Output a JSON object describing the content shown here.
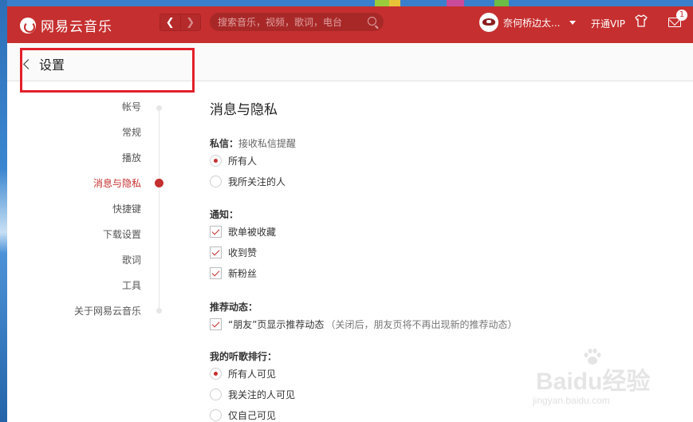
{
  "app": {
    "name": "网易云音乐",
    "search_placeholder": "搜索音乐，视频，歌词，电台",
    "username": "奈何桥边太...",
    "vip_label": "开通VIP",
    "unread_count": "1",
    "colors": {
      "brand": "#c62f2f",
      "highlight_box": "#e2202a"
    }
  },
  "header": {
    "back_title": "设置"
  },
  "sidebar": {
    "items": [
      {
        "label": "帐号",
        "active": false
      },
      {
        "label": "常规",
        "active": false
      },
      {
        "label": "播放",
        "active": false
      },
      {
        "label": "消息与隐私",
        "active": true
      },
      {
        "label": "快捷键",
        "active": false
      },
      {
        "label": "下载设置",
        "active": false
      },
      {
        "label": "歌词",
        "active": false
      },
      {
        "label": "工具",
        "active": false
      },
      {
        "label": "关于网易云音乐",
        "active": false
      }
    ]
  },
  "content": {
    "title": "消息与隐私",
    "private_msg": {
      "label": "私信：",
      "sub": "接收私信提醒",
      "options": [
        {
          "label": "所有人",
          "selected": true
        },
        {
          "label": "我所关注的人",
          "selected": false
        }
      ]
    },
    "notify": {
      "label": "通知：",
      "options": [
        {
          "label": "歌单被收藏",
          "checked": true
        },
        {
          "label": "收到赞",
          "checked": true
        },
        {
          "label": "新粉丝",
          "checked": true
        }
      ]
    },
    "recommend": {
      "label": "推荐动态：",
      "option": {
        "label": "“朋友”页显示推荐动态",
        "note": "（关闭后，朋友页将不再出现新的推荐动态）",
        "checked": true
      }
    },
    "ranking": {
      "label": "我的听歌排行：",
      "options": [
        {
          "label": "所有人可见",
          "selected": true
        },
        {
          "label": "我关注的人可见",
          "selected": false
        },
        {
          "label": "仅自己可见",
          "selected": false
        }
      ]
    }
  },
  "watermark": {
    "brand": "Baidu经验",
    "url": "jingyan.baidu.com"
  }
}
